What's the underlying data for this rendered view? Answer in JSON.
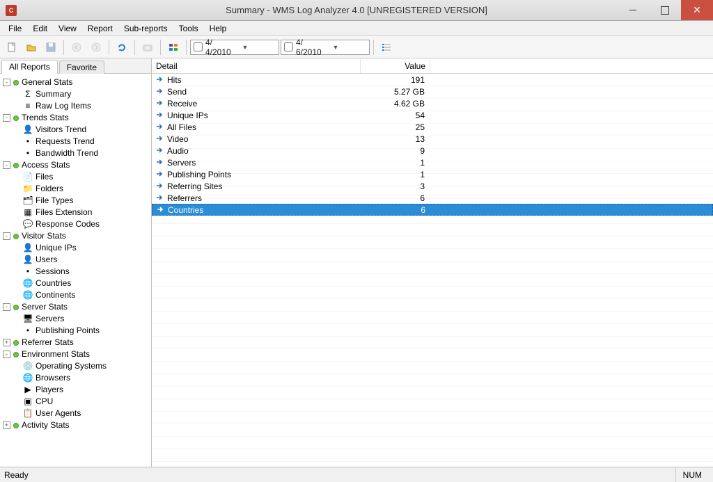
{
  "window": {
    "title": "Summary - WMS Log Analyzer 4.0 [UNREGISTERED VERSION]"
  },
  "menu": [
    "File",
    "Edit",
    "View",
    "Report",
    "Sub-reports",
    "Tools",
    "Help"
  ],
  "date_from": "4/ 4/2010",
  "date_to": "4/ 6/2010",
  "tabs": {
    "all": "All Reports",
    "fav": "Favorite"
  },
  "tree": {
    "general": {
      "label": "General Stats",
      "items": [
        "Summary",
        "Raw Log Items"
      ]
    },
    "trends": {
      "label": "Trends Stats",
      "items": [
        "Visitors Trend",
        "Requests Trend",
        "Bandwidth Trend"
      ]
    },
    "access": {
      "label": "Access Stats",
      "items": [
        "Files",
        "Folders",
        "File Types",
        "Files Extension",
        "Response Codes"
      ]
    },
    "visitor": {
      "label": "Visitor Stats",
      "items": [
        "Unique IPs",
        "Users",
        "Sessions",
        "Countries",
        "Continents"
      ]
    },
    "server": {
      "label": "Server Stats",
      "items": [
        "Servers",
        "Publishing Points"
      ]
    },
    "referrer": {
      "label": "Referrer Stats"
    },
    "env": {
      "label": "Environment Stats",
      "items": [
        "Operating Systems",
        "Browsers",
        "Players",
        "CPU",
        "User Agents"
      ]
    },
    "activity": {
      "label": "Activity Stats"
    }
  },
  "list": {
    "columns": {
      "detail": "Detail",
      "value": "Value"
    },
    "rows": [
      {
        "detail": "Hits",
        "value": "191"
      },
      {
        "detail": "Send",
        "value": "5.27 GB"
      },
      {
        "detail": "Receive",
        "value": "4.62 GB"
      },
      {
        "detail": "Unique IPs",
        "value": "54"
      },
      {
        "detail": "All Files",
        "value": "25"
      },
      {
        "detail": "Video",
        "value": "13"
      },
      {
        "detail": "Audio",
        "value": "9"
      },
      {
        "detail": "Servers",
        "value": "1"
      },
      {
        "detail": "Publishing Points",
        "value": "1"
      },
      {
        "detail": "Referring Sites",
        "value": "3"
      },
      {
        "detail": "Referrers",
        "value": "6"
      },
      {
        "detail": "Countries",
        "value": "6",
        "selected": true
      }
    ]
  },
  "status": {
    "left": "Ready",
    "num": "NUM"
  }
}
